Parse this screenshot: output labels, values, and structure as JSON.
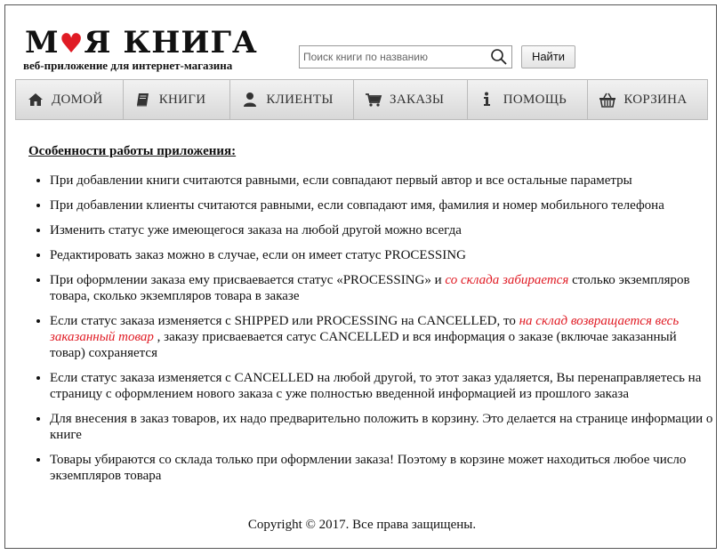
{
  "logo": {
    "title_part1": "М",
    "title_part2": "Я КНИГА",
    "subtitle": "веб-приложение для интернет-магазина"
  },
  "search": {
    "placeholder": "Поиск книги по названию",
    "value": "",
    "button_label": "Найти"
  },
  "nav": {
    "items": [
      {
        "label": "ДОМОЙ",
        "icon": "home-icon"
      },
      {
        "label": "КНИГИ",
        "icon": "book-icon"
      },
      {
        "label": "КЛИЕНТЫ",
        "icon": "user-icon"
      },
      {
        "label": "ЗАКАЗЫ",
        "icon": "cart-icon"
      },
      {
        "label": "ПОМОЩЬ",
        "icon": "info-icon"
      },
      {
        "label": "КОРЗИНА",
        "icon": "basket-icon"
      }
    ]
  },
  "content": {
    "heading": "Особенности работы приложения:",
    "items": [
      {
        "text": "При добавлении книги считаются равными, если совпадают первый автор и все остальные параметры"
      },
      {
        "text": "При добавлении клиенты считаются равными, если совпадают имя, фамилия и номер мобильного телефона"
      },
      {
        "text": "Изменить статус уже имеющегося заказа на любой другой можно всегда"
      },
      {
        "text": "Редактировать заказ можно в случае, если он имеет статус PROCESSING"
      },
      {
        "before": "При оформлении заказа ему присваевается статус «PROCESSING» и ",
        "red": "со склада забирается",
        "after": " столько экземпляров товара, сколько экземпляров товара в заказе"
      },
      {
        "before": "Если статус заказа изменяется с SHIPPED или PROCESSING на CANCELLED, то ",
        "red": "на склад возвращается весь заказанный товар",
        "after": " , заказу присваевается сатус CANCELLED и вся информация о заказе (включае заказанный товар) сохраняется"
      },
      {
        "text": "Если статус заказа изменяется с CANCELLED на любой другой, то этот заказ удаляется, Вы перенаправляетесь на страницу с оформлением нового заказа с уже полностью введенной информацией из прошлого заказа"
      },
      {
        "text": "Для внесения в заказ товаров, их надо предварительно положить в корзину. Это делается на странице информации о книге"
      },
      {
        "text": "Товары убираются со склада только при оформлении заказа! Поэтому в корзине может находиться любое число экземпляров товара"
      }
    ]
  },
  "footer": {
    "text": "Copyright © 2017. Все права защищены."
  },
  "colors": {
    "accent_red": "#e01b24",
    "nav_bg": "#e6e6e6"
  }
}
